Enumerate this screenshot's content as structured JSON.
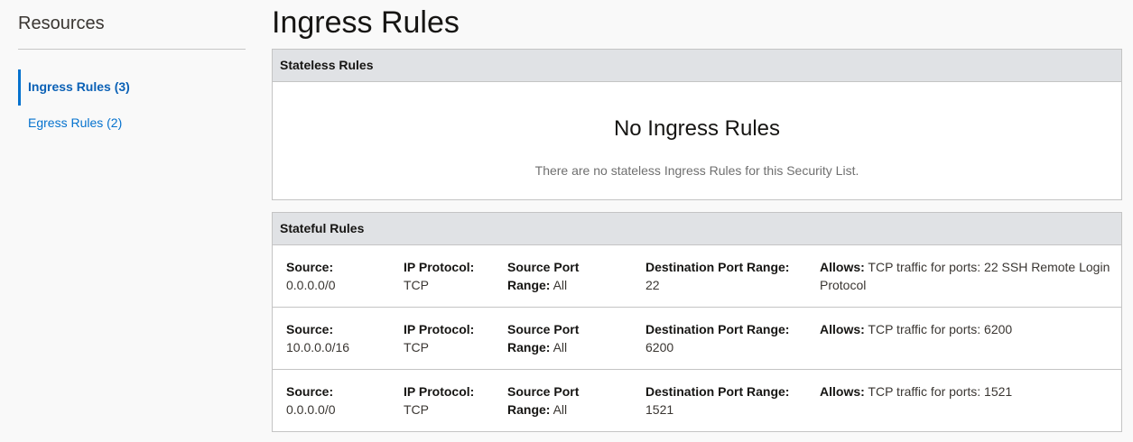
{
  "sidebar": {
    "title": "Resources",
    "items": [
      {
        "label": "Ingress Rules (3)",
        "active": true
      },
      {
        "label": "Egress Rules (2)",
        "active": false
      }
    ]
  },
  "main": {
    "title": "Ingress Rules",
    "stateless": {
      "header": "Stateless Rules",
      "empty_title": "No Ingress Rules",
      "empty_text": "There are no stateless Ingress Rules for this Security List."
    },
    "stateful": {
      "header": "Stateful Rules",
      "labels": {
        "source": "Source:",
        "protocol": "IP Protocol:",
        "source_port_1": "Source Port",
        "source_port_2": "Range:",
        "dest_port": "Destination Port Range:",
        "allows": "Allows:"
      },
      "rows": [
        {
          "source": "0.0.0.0/0",
          "protocol": "TCP",
          "source_port": "All",
          "dest_port": "22",
          "allows": "TCP traffic for ports: 22 SSH Remote Login Protocol"
        },
        {
          "source": "10.0.0.0/16",
          "protocol": "TCP",
          "source_port": "All",
          "dest_port": "6200",
          "allows": "TCP traffic for ports: 6200"
        },
        {
          "source": "0.0.0.0/0",
          "protocol": "TCP",
          "source_port": "All",
          "dest_port": "1521",
          "allows": "TCP traffic for ports: 1521"
        }
      ]
    }
  },
  "colors": {
    "accent": "#0572ce",
    "header_bg": "#e0e2e5",
    "page_bg": "#f9f9f9"
  }
}
